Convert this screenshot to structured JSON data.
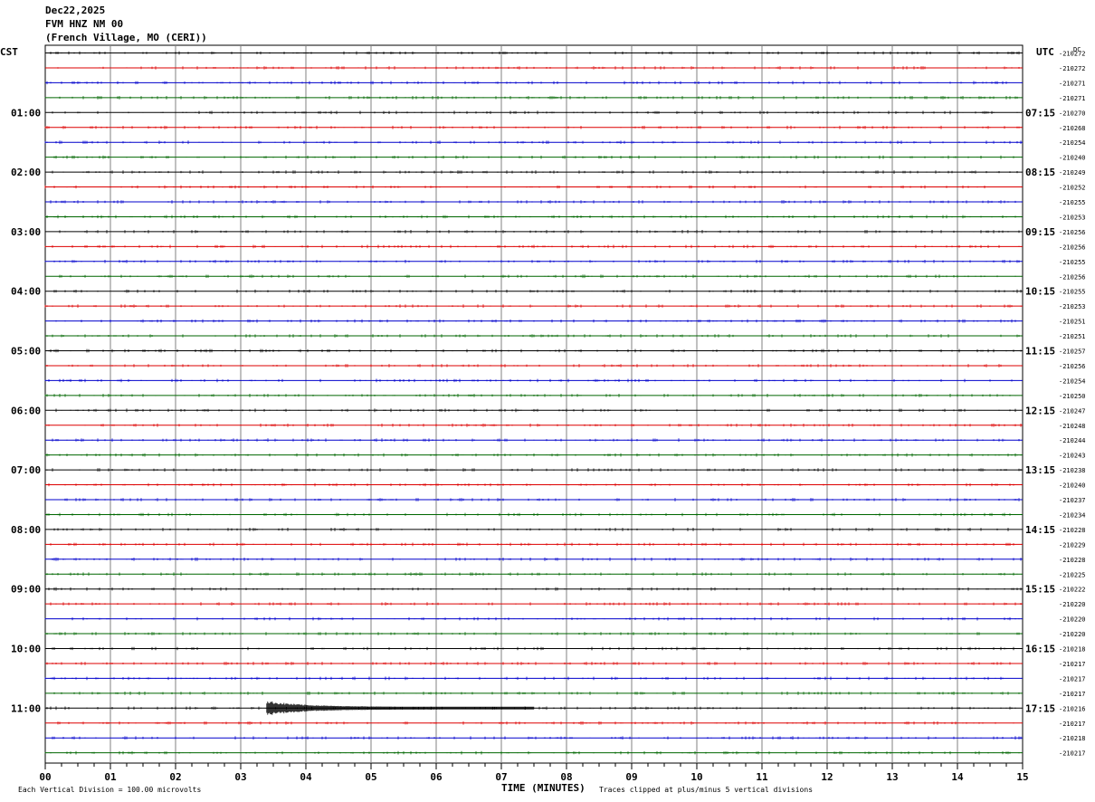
{
  "header": {
    "date": "Dec22,2025",
    "station": "FVM HNZ NM 00",
    "location": "(French Village, MO (CERI))"
  },
  "labels": {
    "left_tz": "CST",
    "right_tz": "UTC",
    "dc_label": "DC"
  },
  "footer": {
    "xlabel": "TIME (MINUTES)",
    "scale_note": "Each Vertical Division =  100.00 microvolts",
    "clip_note": "Traces clipped at plus/minus 5 vertical divisions"
  },
  "chart_data": {
    "type": "line",
    "subtype": "helicorder",
    "xlabel": "TIME (MINUTES)",
    "xlim": [
      0,
      15
    ],
    "x_ticks": [
      "00",
      "01",
      "02",
      "03",
      "04",
      "05",
      "06",
      "07",
      "08",
      "09",
      "10",
      "11",
      "12",
      "13",
      "14",
      "15"
    ],
    "grid": true,
    "trace_colors": [
      "#000000",
      "#dd0000",
      "#0000cc",
      "#006600"
    ],
    "left_hour_labels": [
      "01:00",
      "02:00",
      "03:00",
      "04:00",
      "05:00",
      "06:00",
      "07:00",
      "08:00",
      "09:00",
      "10:00",
      "11:00"
    ],
    "right_hour_labels": [
      "07:15",
      "08:15",
      "09:15",
      "10:15",
      "11:15",
      "12:15",
      "13:15",
      "14:15",
      "15:15",
      "16:15",
      "17:15"
    ],
    "dc_offsets": [
      "-210272",
      "-210272",
      "-210271",
      "-210271",
      "-210270",
      "-210268",
      "-210254",
      "-210240",
      "-210249",
      "-210252",
      "-210255",
      "-210253",
      "-210256",
      "-210256",
      "-210255",
      "-210256",
      "-210255",
      "-210253",
      "-210251",
      "-210251",
      "-210257",
      "-210256",
      "-210254",
      "-210250",
      "-210247",
      "-210248",
      "-210244",
      "-210243",
      "-210238",
      "-210240",
      "-210237",
      "-210234",
      "-210228",
      "-210229",
      "-210228",
      "-210225",
      "-210222",
      "-210220",
      "-210220",
      "-210220",
      "-210218",
      "-210217",
      "-210217",
      "-210217",
      "-210216",
      "-210217",
      "-210218",
      "-210217"
    ],
    "event": {
      "line_index": 44,
      "start_minute": 3.4,
      "end_minute": 7.5
    }
  }
}
